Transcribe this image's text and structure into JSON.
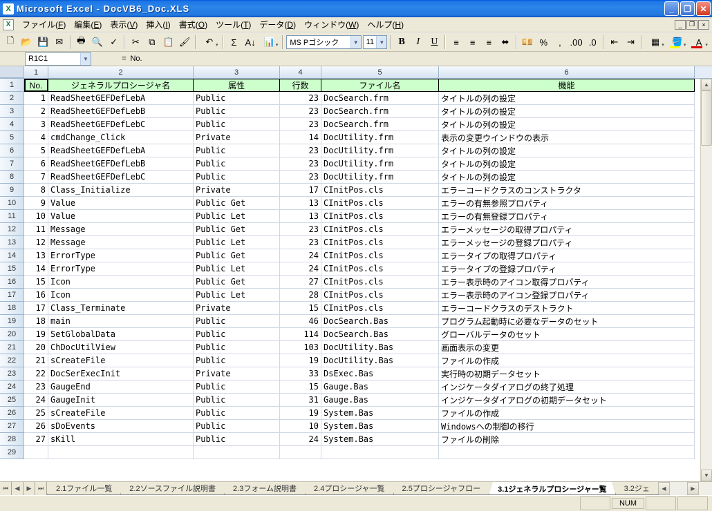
{
  "title": "Microsoft Excel - DocVB6_Doc.XLS",
  "menus": [
    "ファイル(F)",
    "編集(E)",
    "表示(V)",
    "挿入(I)",
    "書式(O)",
    "ツール(T)",
    "データ(D)",
    "ウィンドウ(W)",
    "ヘルプ(H)"
  ],
  "font_name": "MS Pゴシック",
  "font_size": "11",
  "name_box": "R1C1",
  "formula": "No.",
  "col_headers": [
    "1",
    "2",
    "3",
    "4",
    "5",
    "6"
  ],
  "header_cells": [
    "No.",
    "ジェネラルプロシージャ名",
    "属性",
    "行数",
    "ファイル名",
    "機能"
  ],
  "rows": [
    {
      "no": "1",
      "name": "ReadSheetGEFDefLebA",
      "attr": "Public",
      "lines": "23",
      "file": "DocSearch.frm",
      "func": "タイトルの列の設定"
    },
    {
      "no": "2",
      "name": "ReadSheetGEFDefLebB",
      "attr": "Public",
      "lines": "23",
      "file": "DocSearch.frm",
      "func": "タイトルの列の設定"
    },
    {
      "no": "3",
      "name": "ReadSheetGEFDefLebC",
      "attr": "Public",
      "lines": "23",
      "file": "DocSearch.frm",
      "func": "タイトルの列の設定"
    },
    {
      "no": "4",
      "name": "cmdChange_Click",
      "attr": "Private",
      "lines": "14",
      "file": "DocUtility.frm",
      "func": "表示の変更ウインドウの表示"
    },
    {
      "no": "5",
      "name": "ReadSheetGEFDefLebA",
      "attr": "Public",
      "lines": "23",
      "file": "DocUtility.frm",
      "func": "タイトルの列の設定"
    },
    {
      "no": "6",
      "name": "ReadSheetGEFDefLebB",
      "attr": "Public",
      "lines": "23",
      "file": "DocUtility.frm",
      "func": "タイトルの列の設定"
    },
    {
      "no": "7",
      "name": "ReadSheetGEFDefLebC",
      "attr": "Public",
      "lines": "23",
      "file": "DocUtility.frm",
      "func": "タイトルの列の設定"
    },
    {
      "no": "8",
      "name": "Class_Initialize",
      "attr": "Private",
      "lines": "17",
      "file": "CInitPos.cls",
      "func": "エラーコードクラスのコンストラクタ"
    },
    {
      "no": "9",
      "name": "Value",
      "attr": "Public Get",
      "lines": "13",
      "file": "CInitPos.cls",
      "func": "エラーの有無参照プロパティ"
    },
    {
      "no": "10",
      "name": "Value",
      "attr": "Public Let",
      "lines": "13",
      "file": "CInitPos.cls",
      "func": "エラーの有無登録プロパティ"
    },
    {
      "no": "11",
      "name": "Message",
      "attr": "Public Get",
      "lines": "23",
      "file": "CInitPos.cls",
      "func": "エラーメッセージの取得プロパティ"
    },
    {
      "no": "12",
      "name": "Message",
      "attr": "Public Let",
      "lines": "23",
      "file": "CInitPos.cls",
      "func": "エラーメッセージの登録プロパティ"
    },
    {
      "no": "13",
      "name": "ErrorType",
      "attr": "Public Get",
      "lines": "24",
      "file": "CInitPos.cls",
      "func": "エラータイプの取得プロパティ"
    },
    {
      "no": "14",
      "name": "ErrorType",
      "attr": "Public Let",
      "lines": "24",
      "file": "CInitPos.cls",
      "func": "エラータイプの登録プロパティ"
    },
    {
      "no": "15",
      "name": "Icon",
      "attr": "Public Get",
      "lines": "27",
      "file": "CInitPos.cls",
      "func": "エラー表示時のアイコン取得プロパティ"
    },
    {
      "no": "16",
      "name": "Icon",
      "attr": "Public Let",
      "lines": "28",
      "file": "CInitPos.cls",
      "func": "エラー表示時のアイコン登録プロパティ"
    },
    {
      "no": "17",
      "name": "Class_Terminate",
      "attr": "Private",
      "lines": "15",
      "file": "CInitPos.cls",
      "func": "エラーコードクラスのデストラクト"
    },
    {
      "no": "18",
      "name": "main",
      "attr": "Public",
      "lines": "46",
      "file": "DocSearch.Bas",
      "func": "プログラム起動時に必要なデータのセット"
    },
    {
      "no": "19",
      "name": "SetGlobalData",
      "attr": "Public",
      "lines": "114",
      "file": "DocSearch.Bas",
      "func": "グローバルデータのセット"
    },
    {
      "no": "20",
      "name": "ChDocUtilView",
      "attr": "Public",
      "lines": "103",
      "file": "DocUtility.Bas",
      "func": "画面表示の変更"
    },
    {
      "no": "21",
      "name": "sCreateFile",
      "attr": "Public",
      "lines": "19",
      "file": "DocUtility.Bas",
      "func": "ファイルの作成"
    },
    {
      "no": "22",
      "name": "DocSerExecInit",
      "attr": "Private",
      "lines": "33",
      "file": "DsExec.Bas",
      "func": "実行時の初期データセット"
    },
    {
      "no": "23",
      "name": "GaugeEnd",
      "attr": "Public",
      "lines": "15",
      "file": "Gauge.Bas",
      "func": "インジケータダイアログの終了処理"
    },
    {
      "no": "24",
      "name": "GaugeInit",
      "attr": "Public",
      "lines": "31",
      "file": "Gauge.Bas",
      "func": "インジケータダイアログの初期データセット"
    },
    {
      "no": "25",
      "name": "sCreateFile",
      "attr": "Public",
      "lines": "19",
      "file": "System.Bas",
      "func": "ファイルの作成"
    },
    {
      "no": "26",
      "name": "sDoEvents",
      "attr": "Public",
      "lines": "10",
      "file": "System.Bas",
      "func": "Windowsへの制御の移行"
    },
    {
      "no": "27",
      "name": "sKill",
      "attr": "Public",
      "lines": "24",
      "file": "System.Bas",
      "func": "ファイルの削除"
    }
  ],
  "sheet_tabs": [
    "2.1ファイル一覧",
    "2.2ソースファイル説明書",
    "2.3フォーム説明書",
    "2.4プロシージャ一覧",
    "2.5プロシージャフロー",
    "3.1ジェネラルプロシージャー覧",
    "3.2ジェ"
  ],
  "active_tab_index": 5,
  "status_indicator": "NUM"
}
